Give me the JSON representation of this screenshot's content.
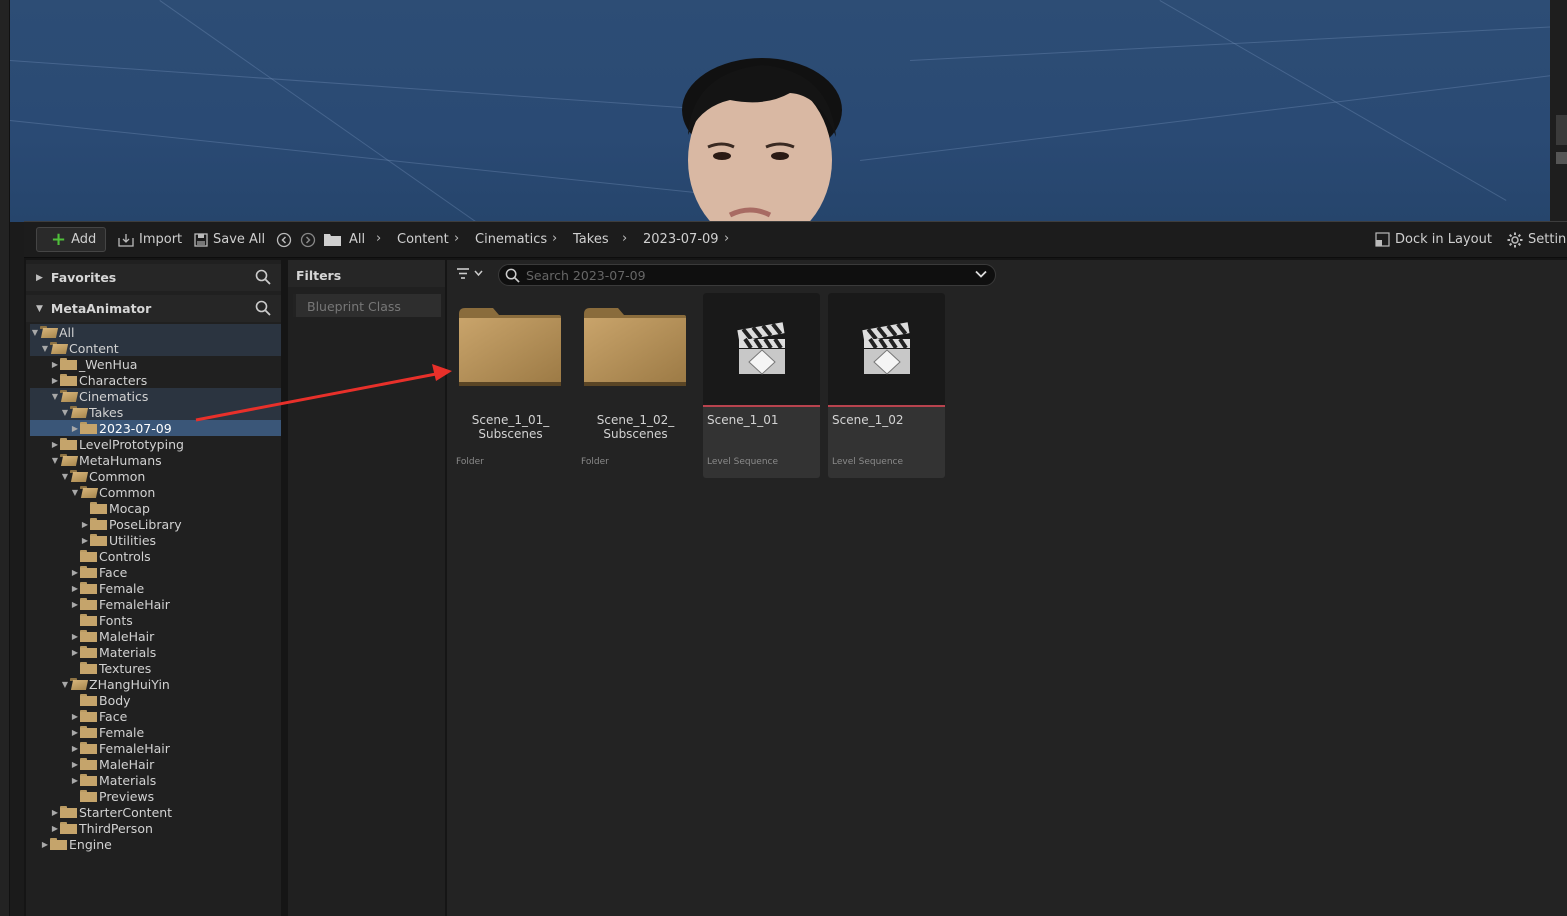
{
  "toolbar": {
    "add_label": "Add",
    "import_label": "Import",
    "save_all_label": "Save All",
    "breadcrumb": [
      "All",
      "Content",
      "Cinematics",
      "Takes",
      "2023-07-09"
    ],
    "dock_label": "Dock in Layout",
    "settings_label": "Settings"
  },
  "left_panel": {
    "favorites_label": "Favorites",
    "project_label": "MetaAnimator",
    "tree": [
      {
        "label": "All",
        "depth": 0,
        "expanded": true,
        "arrow": true,
        "open": true
      },
      {
        "label": "Content",
        "depth": 1,
        "expanded": true,
        "arrow": true,
        "open": true
      },
      {
        "label": "_WenHua",
        "depth": 2,
        "expanded": false,
        "arrow": true
      },
      {
        "label": "Characters",
        "depth": 2,
        "expanded": false,
        "arrow": true
      },
      {
        "label": "Cinematics",
        "depth": 2,
        "expanded": true,
        "arrow": true,
        "open": true
      },
      {
        "label": "Takes",
        "depth": 3,
        "expanded": true,
        "arrow": true,
        "open": true
      },
      {
        "label": "2023-07-09",
        "depth": 4,
        "expanded": false,
        "arrow": true,
        "selected": true
      },
      {
        "label": "LevelPrototyping",
        "depth": 2,
        "expanded": false,
        "arrow": true
      },
      {
        "label": "MetaHumans",
        "depth": 2,
        "expanded": true,
        "arrow": true,
        "open": true
      },
      {
        "label": "Common",
        "depth": 3,
        "expanded": true,
        "arrow": true,
        "open": true
      },
      {
        "label": "Common",
        "depth": 4,
        "expanded": true,
        "arrow": true,
        "open": true
      },
      {
        "label": "Mocap",
        "depth": 5,
        "arrow": false
      },
      {
        "label": "PoseLibrary",
        "depth": 5,
        "expanded": false,
        "arrow": true
      },
      {
        "label": "Utilities",
        "depth": 5,
        "expanded": false,
        "arrow": true
      },
      {
        "label": "Controls",
        "depth": 4,
        "arrow": false
      },
      {
        "label": "Face",
        "depth": 4,
        "expanded": false,
        "arrow": true
      },
      {
        "label": "Female",
        "depth": 4,
        "expanded": false,
        "arrow": true
      },
      {
        "label": "FemaleHair",
        "depth": 4,
        "expanded": false,
        "arrow": true
      },
      {
        "label": "Fonts",
        "depth": 4,
        "arrow": false
      },
      {
        "label": "MaleHair",
        "depth": 4,
        "expanded": false,
        "arrow": true
      },
      {
        "label": "Materials",
        "depth": 4,
        "expanded": false,
        "arrow": true
      },
      {
        "label": "Textures",
        "depth": 4,
        "arrow": false
      },
      {
        "label": "ZHangHuiYin",
        "depth": 3,
        "expanded": true,
        "arrow": true,
        "open": true
      },
      {
        "label": "Body",
        "depth": 4,
        "arrow": false
      },
      {
        "label": "Face",
        "depth": 4,
        "expanded": false,
        "arrow": true
      },
      {
        "label": "Female",
        "depth": 4,
        "expanded": false,
        "arrow": true
      },
      {
        "label": "FemaleHair",
        "depth": 4,
        "expanded": false,
        "arrow": true
      },
      {
        "label": "MaleHair",
        "depth": 4,
        "expanded": false,
        "arrow": true
      },
      {
        "label": "Materials",
        "depth": 4,
        "expanded": false,
        "arrow": true
      },
      {
        "label": "Previews",
        "depth": 4,
        "arrow": false
      },
      {
        "label": "StarterContent",
        "depth": 2,
        "expanded": false,
        "arrow": true
      },
      {
        "label": "ThirdPerson",
        "depth": 2,
        "expanded": false,
        "arrow": true
      },
      {
        "label": "Engine",
        "depth": 1,
        "expanded": false,
        "arrow": true
      }
    ]
  },
  "filters": {
    "header": "Filters",
    "chip": "Blueprint Class"
  },
  "assets": {
    "search_placeholder": "Search 2023-07-09",
    "items": [
      {
        "name_line1": "Scene_1_01_",
        "name_line2": "Subscenes",
        "type": "Folder"
      },
      {
        "name_line1": "Scene_1_02_",
        "name_line2": "Subscenes",
        "type": "Folder"
      },
      {
        "name_line1": "Scene_1_01",
        "name_line2": "",
        "type": "Level Sequence"
      },
      {
        "name_line1": "Scene_1_02",
        "name_line2": "",
        "type": "Level Sequence"
      }
    ]
  },
  "colors": {
    "accent_add": "#4fbf3a",
    "selection": "#3a5678",
    "sequence_bar": "#b8434e",
    "annotation_arrow": "#e8302a"
  }
}
